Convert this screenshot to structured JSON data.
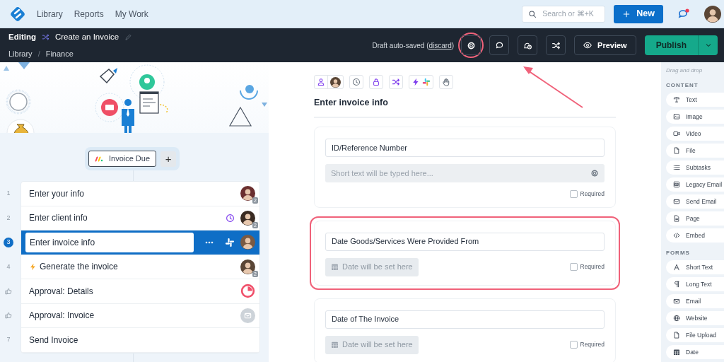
{
  "topnav": {
    "links": [
      "Library",
      "Reports",
      "My Work"
    ],
    "search": {
      "placeholder": "Search or ⌘+K"
    },
    "new_button": "New",
    "notification": true
  },
  "editbar": {
    "mode": "Editing",
    "title": "Create an Invoice",
    "breadcrumb": [
      "Library",
      "Finance"
    ],
    "breadcrumb_separator": "/",
    "status_before": "Draft auto-saved (",
    "discard": "discard",
    "status_after": ")",
    "tools": [
      {
        "kind": "settings",
        "highlighted": true
      },
      {
        "kind": "comment",
        "highlighted": false
      },
      {
        "kind": "reminder",
        "highlighted": false
      },
      {
        "kind": "shuffle",
        "highlighted": false
      }
    ],
    "preview": "Preview",
    "publish": "Publish"
  },
  "trigger": {
    "label": "Invoice Due",
    "add": "+"
  },
  "steps": [
    {
      "kind": "task",
      "number": "1",
      "title": "Enter your info",
      "selected": false,
      "automated": false,
      "timer": false,
      "menu": false,
      "slack": false,
      "end": {
        "kind": "avatar",
        "count": "2"
      }
    },
    {
      "kind": "task",
      "number": "2",
      "title": "Enter client info",
      "selected": false,
      "automated": false,
      "timer": true,
      "menu": false,
      "slack": false,
      "end": {
        "kind": "avatar",
        "count": "2"
      }
    },
    {
      "kind": "task",
      "number": "3",
      "title": "Enter invoice info",
      "selected": true,
      "automated": false,
      "timer": false,
      "menu": true,
      "slack": true,
      "end": {
        "kind": "avatar"
      }
    },
    {
      "kind": "task",
      "number": "4",
      "title": "Generate the invoice",
      "selected": false,
      "automated": true,
      "timer": false,
      "menu": false,
      "slack": false,
      "end": {
        "kind": "avatar",
        "count": "2"
      }
    },
    {
      "kind": "approval",
      "title": "Approval: Details",
      "selected": false,
      "automated": false,
      "timer": false,
      "menu": false,
      "slack": false,
      "end": {
        "kind": "pie"
      }
    },
    {
      "kind": "approval",
      "title": "Approval: Invoice",
      "selected": false,
      "automated": false,
      "timer": false,
      "menu": false,
      "slack": false,
      "end": {
        "kind": "mail"
      }
    },
    {
      "kind": "task",
      "number": "7",
      "title": "Send Invoice",
      "selected": false,
      "automated": false,
      "timer": false,
      "menu": false,
      "slack": false
    }
  ],
  "task": {
    "toolbar": [
      {
        "kind": "assignee"
      },
      {
        "kind": "due_date"
      },
      {
        "kind": "permissions"
      },
      {
        "kind": "logic"
      },
      {
        "kind": "automation"
      },
      {
        "kind": "stop"
      }
    ],
    "title": "Enter invoice info",
    "fields": [
      {
        "kind": "short_text",
        "label": "ID/Reference Number",
        "placeholder": "Short text will be typed here...",
        "required": false,
        "required_label": "Required",
        "highlighted": false
      },
      {
        "kind": "date",
        "label": "Date Goods/Services Were Provided From",
        "placeholder": "Date will be set here",
        "required": false,
        "required_label": "Required",
        "highlighted": true
      },
      {
        "kind": "date",
        "label": "Date of The Invoice",
        "placeholder": "Date will be set here",
        "required": false,
        "required_label": "Required",
        "highlighted": false
      }
    ]
  },
  "palette": {
    "hint": "Drag and drop",
    "sections": [
      {
        "title": "CONTENT",
        "items": [
          {
            "label": "Text",
            "kind": "text"
          },
          {
            "label": "Image",
            "kind": "image"
          },
          {
            "label": "Video",
            "kind": "video"
          },
          {
            "label": "File",
            "kind": "file"
          },
          {
            "label": "Subtasks",
            "kind": "subtasks"
          },
          {
            "label": "Legacy Email",
            "kind": "legacy_email"
          },
          {
            "label": "Send Email",
            "kind": "email"
          },
          {
            "label": "Page",
            "kind": "page"
          },
          {
            "label": "Embed",
            "kind": "embed"
          }
        ]
      },
      {
        "title": "FORMS",
        "items": [
          {
            "label": "Short Text",
            "kind": "short_text"
          },
          {
            "label": "Long Text",
            "kind": "long_text"
          },
          {
            "label": "Email",
            "kind": "email"
          },
          {
            "label": "Website",
            "kind": "website"
          },
          {
            "label": "File Upload",
            "kind": "file_upload"
          },
          {
            "label": "Date",
            "kind": "date"
          }
        ]
      }
    ]
  },
  "annotation_arrow": true
}
